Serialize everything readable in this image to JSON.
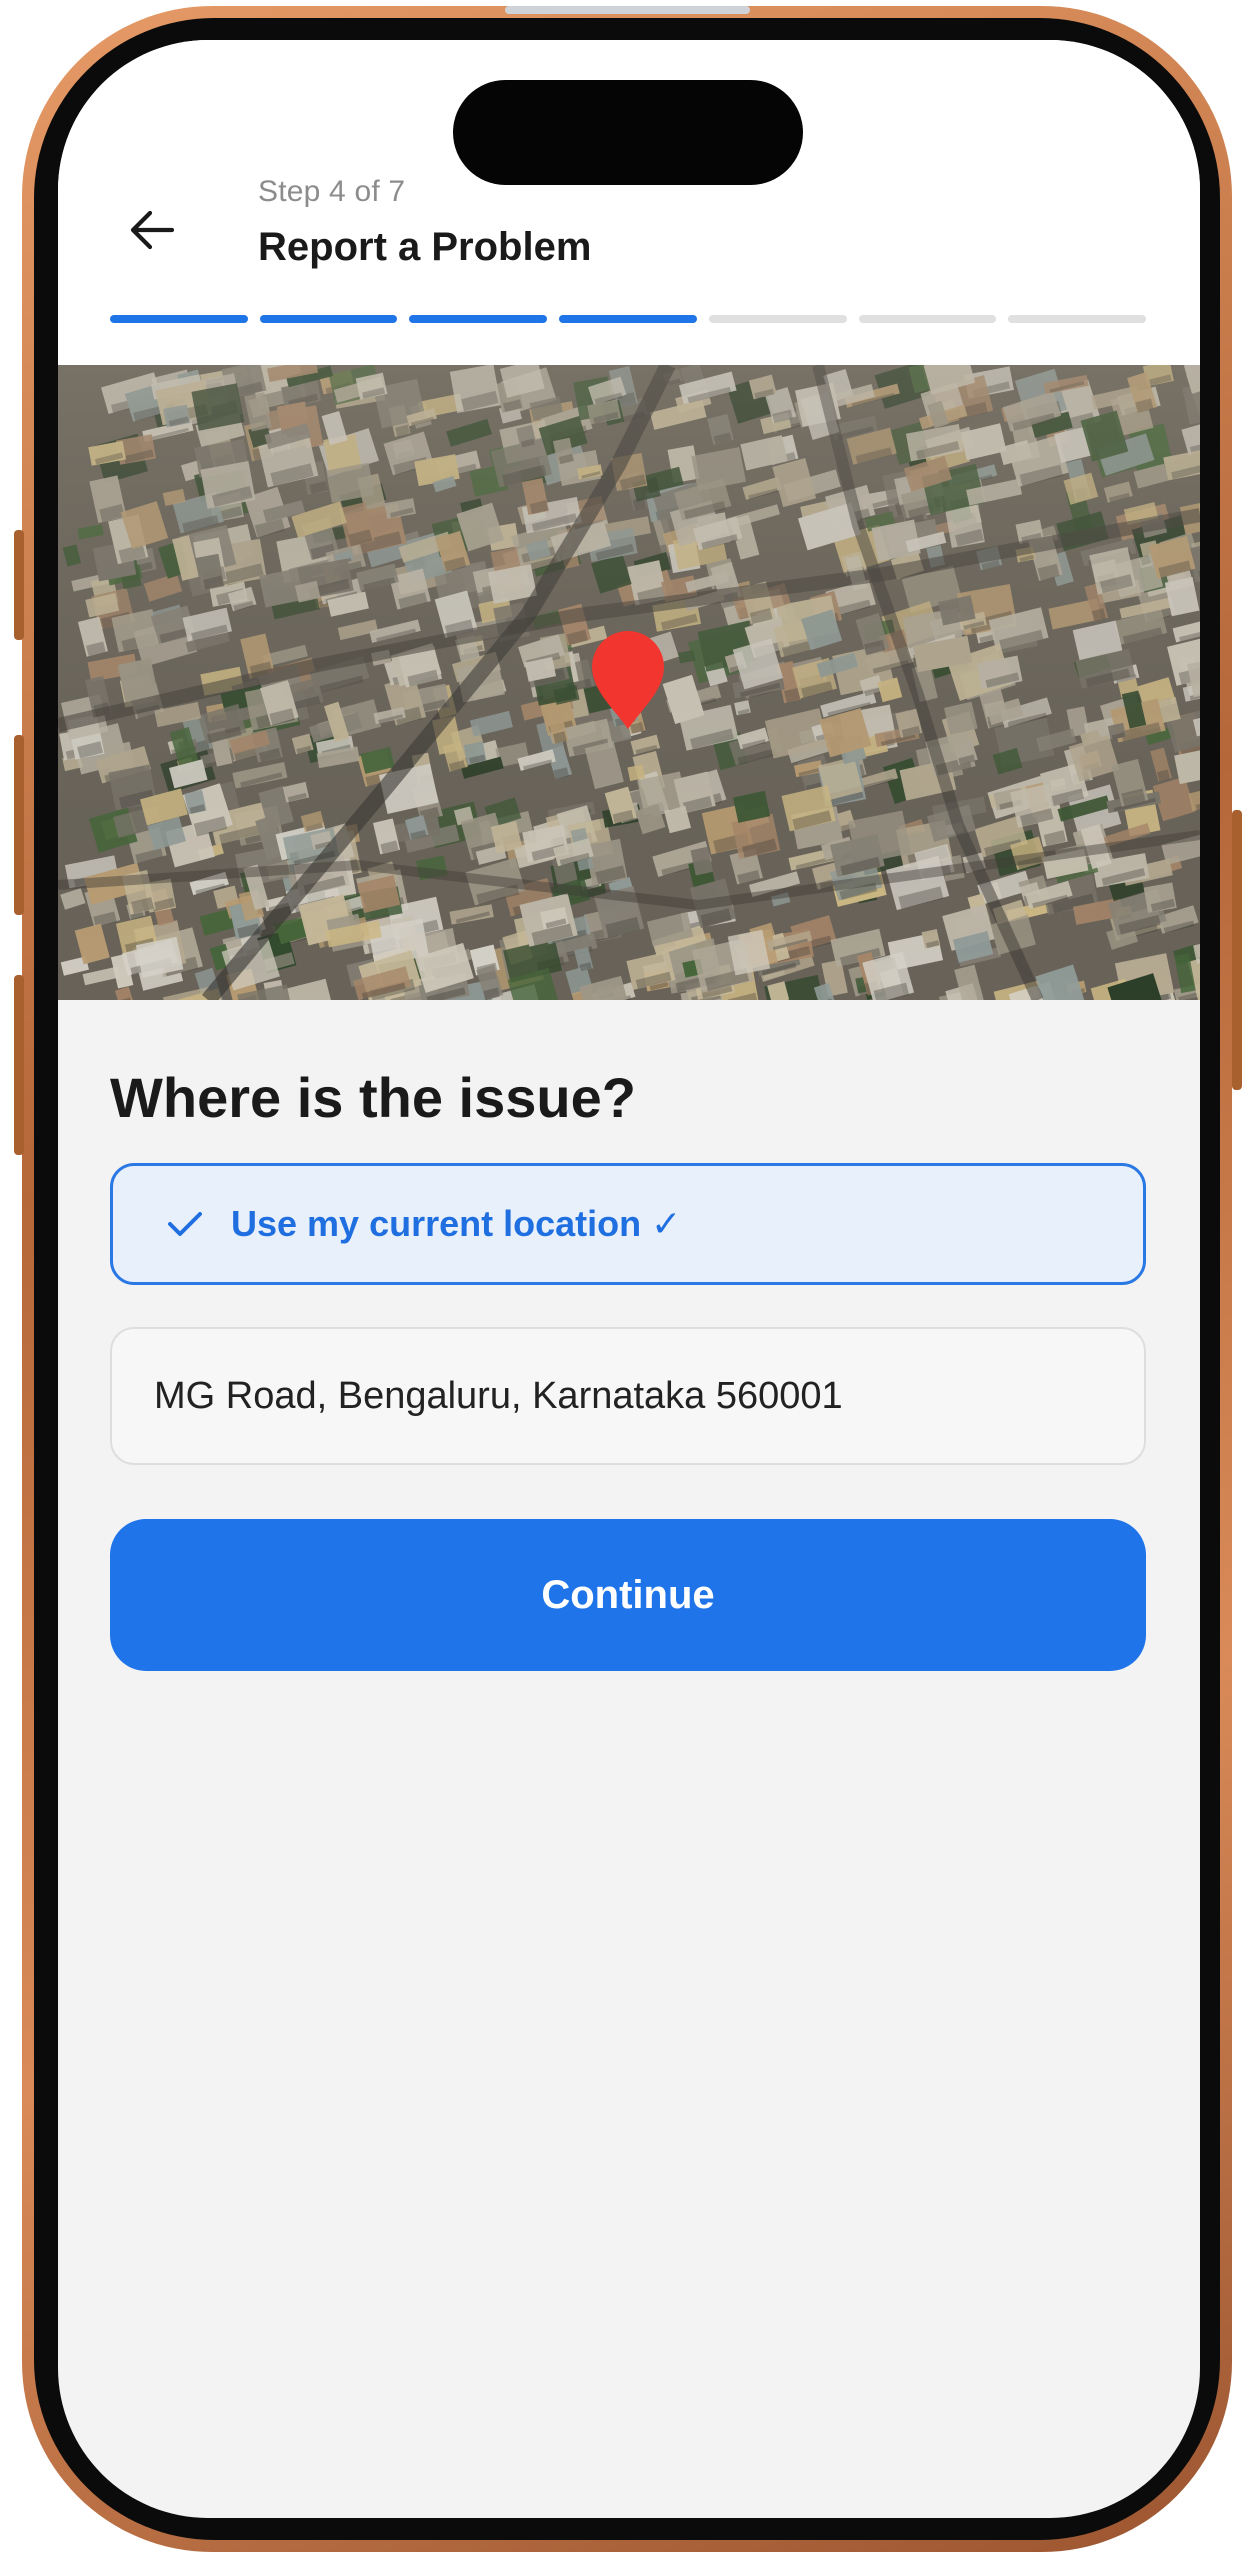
{
  "header": {
    "step_label": "Step 4 of 7",
    "title": "Report a Problem",
    "progress": {
      "current_step": 4,
      "total_steps": 7
    }
  },
  "map": {
    "pin_icon": "map-pin-icon",
    "pin_color": "#f2362f"
  },
  "form": {
    "question": "Where is the issue?",
    "current_location_label": "Use my current location ✓",
    "current_location_selected": true,
    "address_value": "MG Road, Bengaluru, Karnataka 560001",
    "continue_label": "Continue"
  },
  "colors": {
    "accent": "#1e74e8",
    "selected_bg": "#e8f0fb",
    "frame": "#c47a46"
  }
}
